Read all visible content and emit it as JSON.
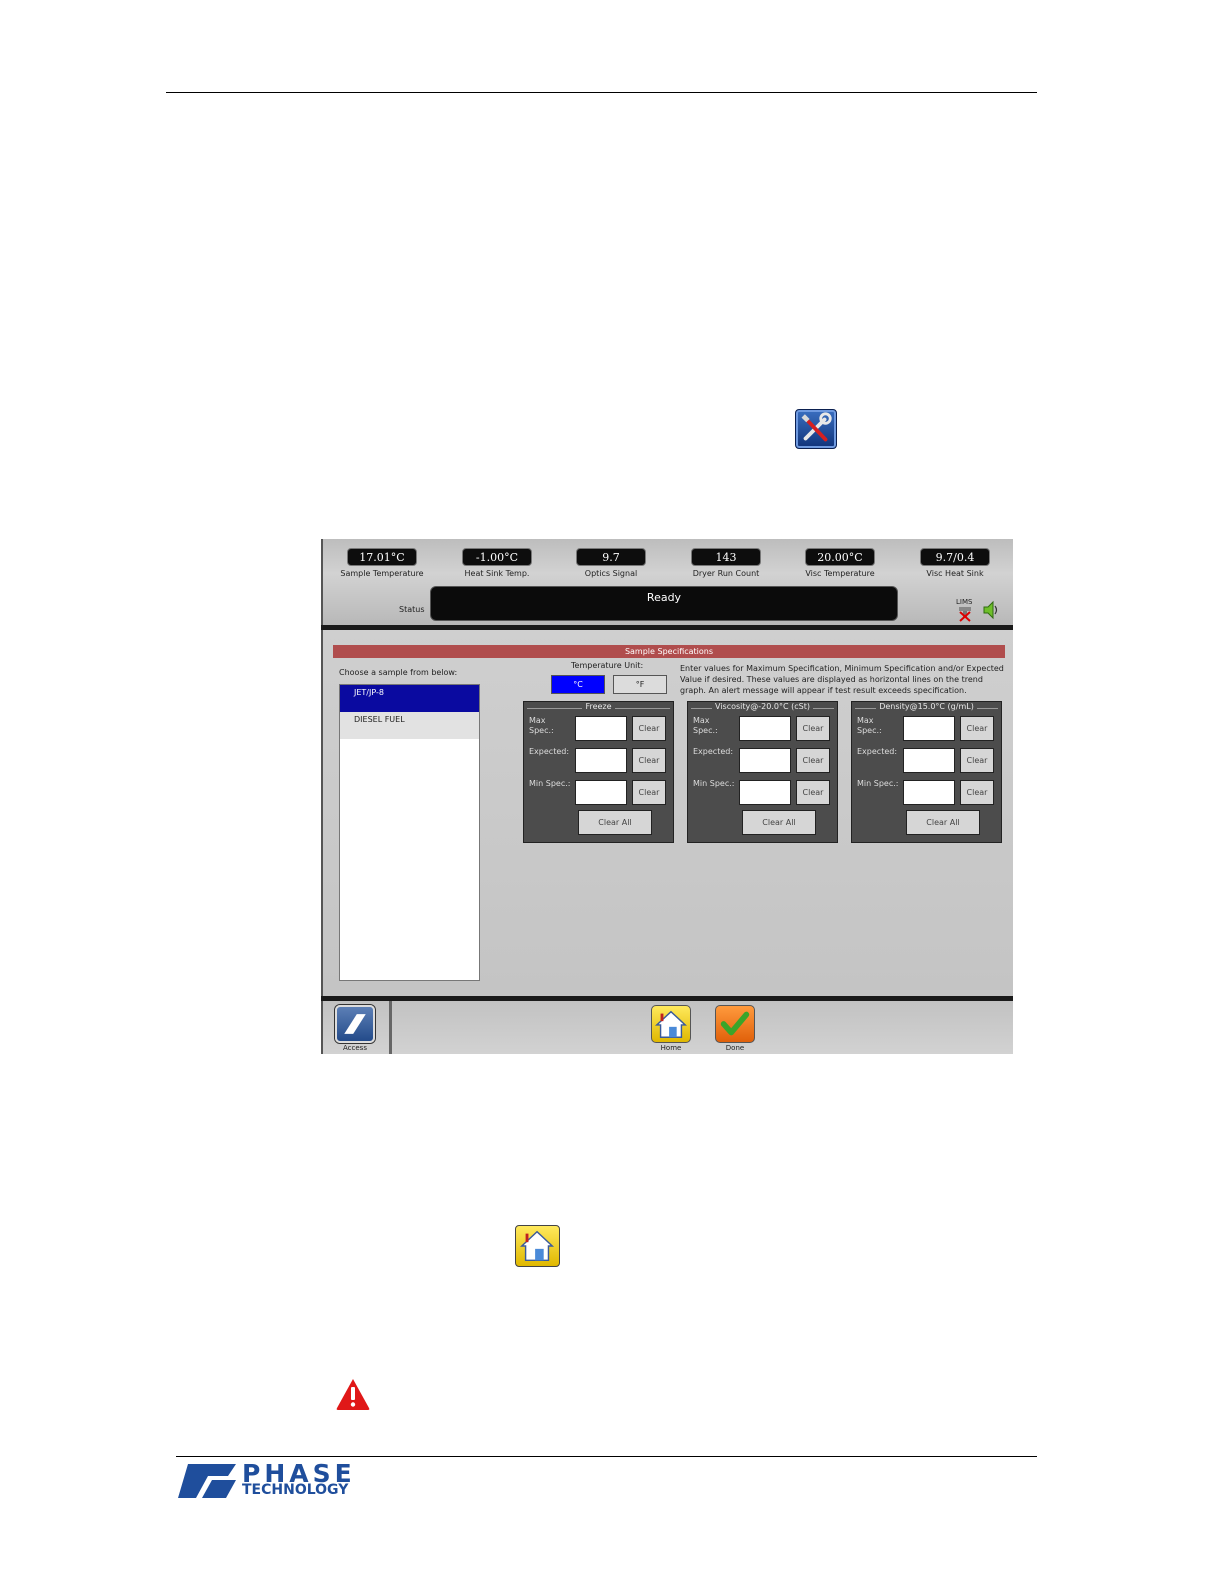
{
  "readings": [
    {
      "value": "17.01°C",
      "label": "Sample Temperature"
    },
    {
      "value": "-1.00°C",
      "label": "Heat Sink Temp."
    },
    {
      "value": "9.7",
      "label": "Optics Signal"
    },
    {
      "value": "143",
      "label": "Dryer Run Count"
    },
    {
      "value": "20.00°C",
      "label": "Visc Temperature"
    },
    {
      "value": "9.7/0.4",
      "label": "Visc Heat Sink"
    }
  ],
  "status": {
    "label": "Status",
    "value": "Ready"
  },
  "lims_label": "LIMS",
  "sample_specs": {
    "title": "Sample Specifications",
    "choose_label": "Choose a sample from below:",
    "samples": [
      "JET/JP-8",
      "DIESEL FUEL"
    ],
    "temp_unit_label": "Temperature Unit:",
    "unit_c": "°C",
    "unit_f": "°F",
    "help_text": "Enter values for Maximum Specification, Minimum Specification and/or Expected Value if desired. These values are displayed as horizontal lines on the trend graph. An alert message will appear if test result exceeds specification.",
    "groups": [
      {
        "title": "Freeze"
      },
      {
        "title": "Viscosity@-20.0°C (cSt)"
      },
      {
        "title": "Density@15.0°C (g/mL)"
      }
    ],
    "max_spec_label_1": "Max",
    "max_spec_label_2": "Spec.:",
    "expected_label": "Expected:",
    "min_spec_label": "Min Spec.:",
    "clear_label": "Clear",
    "clear_all_label": "Clear All"
  },
  "bottom": {
    "access_label": "Access",
    "home_label": "Home",
    "done_label": "Done"
  },
  "logo": {
    "line1": "PHASE",
    "line2": "TECHNOLOGY"
  },
  "colors": {
    "brand_blue": "#1f4e9c",
    "selected_blue": "#0a0aa0",
    "spec_bar": "#b04d4d"
  }
}
